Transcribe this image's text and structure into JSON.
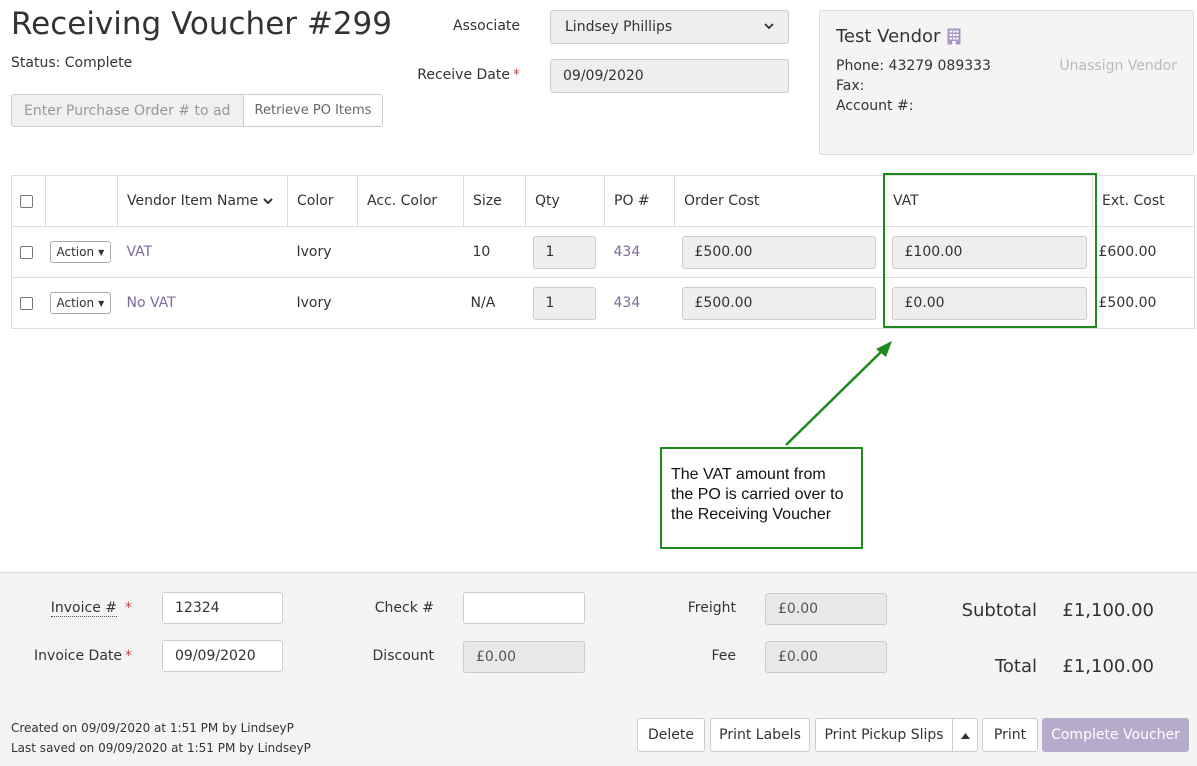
{
  "header": {
    "title": "Receiving Voucher #299",
    "status": "Status: Complete",
    "po_placeholder": "Enter Purchase Order # to add i",
    "retrieve_label": "Retrieve PO Items",
    "associate_label": "Associate",
    "associate_value": "Lindsey Phillips",
    "receive_date_label": "Receive Date",
    "required_mark": "*",
    "receive_date_value": "09/09/2020"
  },
  "vendor": {
    "name": "Test Vendor",
    "phone": "Phone: 43279 089333",
    "fax": "Fax:",
    "account": "Account #:",
    "unassign_label": "Unassign Vendor"
  },
  "table": {
    "columns": [
      "Vendor Item Name",
      "Color",
      "Acc. Color",
      "Size",
      "Qty",
      "PO #",
      "Order Cost",
      "VAT",
      "Ext. Cost"
    ],
    "action_label": "Action",
    "rows": [
      {
        "name": "VAT",
        "color": "Ivory",
        "acc_color": "",
        "size": "10",
        "qty": "1",
        "po": "434",
        "order_cost": "£500.00",
        "vat": "£100.00",
        "ext_cost": "£600.00"
      },
      {
        "name": "No VAT",
        "color": "Ivory",
        "acc_color": "",
        "size": "N/A",
        "qty": "1",
        "po": "434",
        "order_cost": "£500.00",
        "vat": "£0.00",
        "ext_cost": "£500.00"
      }
    ]
  },
  "annotation": {
    "text": "The VAT amount from the PO is carried over to the Receiving Voucher",
    "color": "#1c8a1c"
  },
  "footer": {
    "invoice_label": "Invoice #",
    "invoice_value": "12324",
    "invoice_date_label": "Invoice Date",
    "invoice_date_value": "09/09/2020",
    "check_label": "Check #",
    "check_value": "",
    "discount_label": "Discount",
    "discount_value": "£0.00",
    "freight_label": "Freight",
    "freight_value": "£0.00",
    "fee_label": "Fee",
    "fee_value": "£0.00",
    "subtotal_label": "Subtotal",
    "subtotal_value": "£1,100.00",
    "total_label": "Total",
    "total_value": "£1,100.00",
    "created": "Created on 09/09/2020 at 1:51 PM by LindseyP",
    "last_saved": "Last saved on 09/09/2020 at 1:51 PM by LindseyP",
    "buttons": {
      "delete": "Delete",
      "print_labels": "Print Labels",
      "print_pickup_slips": "Print Pickup Slips",
      "print": "Print",
      "complete": "Complete Voucher"
    }
  },
  "colors": {
    "link": "#7b6a9c",
    "primary_button": "#b7abcb",
    "required": "#b94a48"
  }
}
